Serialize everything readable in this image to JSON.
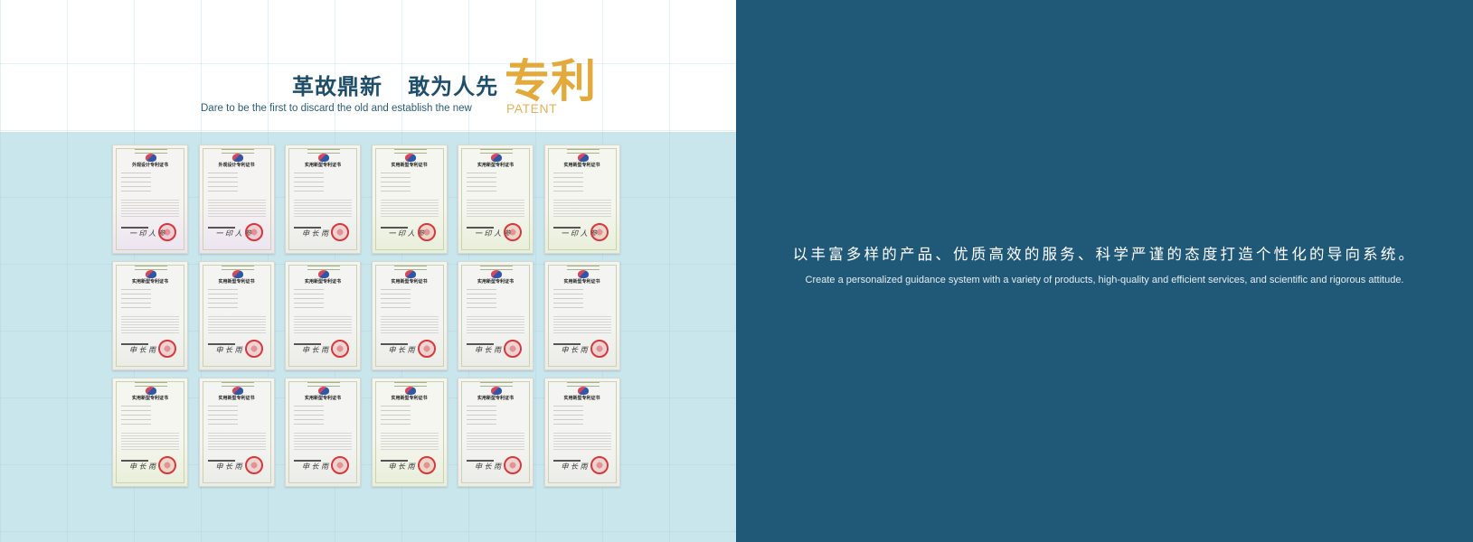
{
  "header": {
    "title_cn": "革故鼎新   敢为人先",
    "title_en": "Dare to be the first to discard the old and establish the new",
    "badge_cn": "专利",
    "badge_en": "PATENT"
  },
  "certificates": [
    {
      "title": "外观设计专利证书",
      "tint": "purple",
      "sign": "一 印 人 参"
    },
    {
      "title": "外观设计专利证书",
      "tint": "purple",
      "sign": "一 印 人 参"
    },
    {
      "title": "实用新型专利证书",
      "tint": "gray",
      "sign": "申 长 雨"
    },
    {
      "title": "实用新型专利证书",
      "tint": "green",
      "sign": "一 印 人 参"
    },
    {
      "title": "实用新型专利证书",
      "tint": "green",
      "sign": "一 印 人 参"
    },
    {
      "title": "实用新型专利证书",
      "tint": "green",
      "sign": "一 印 人 参"
    },
    {
      "title": "实用新型专利证书",
      "tint": "gray",
      "sign": "申 长 雨"
    },
    {
      "title": "实用新型专利证书",
      "tint": "gray",
      "sign": "申 长 雨"
    },
    {
      "title": "实用新型专利证书",
      "tint": "gray",
      "sign": "申 长 雨"
    },
    {
      "title": "实用新型专利证书",
      "tint": "gray",
      "sign": "申 长 雨"
    },
    {
      "title": "实用新型专利证书",
      "tint": "gray",
      "sign": "申 长 雨"
    },
    {
      "title": "实用新型专利证书",
      "tint": "gray",
      "sign": "申 长 雨"
    },
    {
      "title": "实用新型专利证书",
      "tint": "green",
      "sign": "申 长 雨"
    },
    {
      "title": "实用新型专利证书",
      "tint": "gray",
      "sign": "申 长 雨"
    },
    {
      "title": "实用新型专利证书",
      "tint": "gray",
      "sign": "申 长 雨"
    },
    {
      "title": "实用新型专利证书",
      "tint": "green",
      "sign": "申 长 雨"
    },
    {
      "title": "实用新型专利证书",
      "tint": "gray",
      "sign": "申 长 雨"
    },
    {
      "title": "实用新型专利证书",
      "tint": "gray",
      "sign": "申 长 雨"
    }
  ],
  "right_panel": {
    "slogan_cn": "以丰富多样的产品、优质高效的服务、科学严谨的态度打造个性化的导向系统。",
    "slogan_en": "Create a personalized guidance system with a variety of products, high-quality and efficient services, and scientific and rigorous attitude."
  },
  "colors": {
    "left_bg": "#c9e6ec",
    "right_bg": "#205877",
    "title_blue": "#1f4e6b",
    "accent_gold": "#e3a93a"
  }
}
